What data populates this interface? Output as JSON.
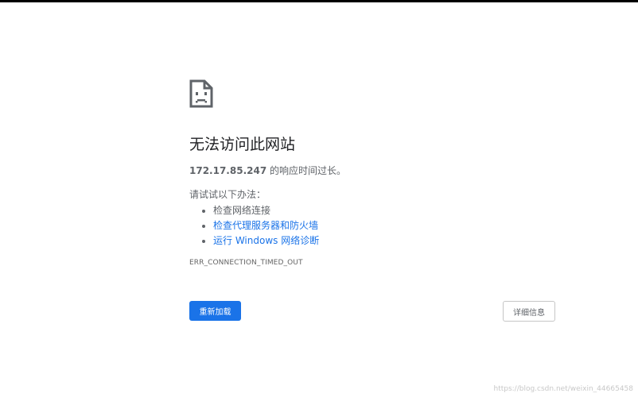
{
  "error_page": {
    "title": "无法访问此网站",
    "host": "172.17.85.247",
    "description_suffix": " 的响应时间过长。",
    "suggestions_heading": "请试试以下办法：",
    "suggestions": [
      {
        "label": "检查网络连接",
        "link": false
      },
      {
        "label": "检查代理服务器和防火墙",
        "link": true
      },
      {
        "label": "运行 Windows 网络诊断",
        "link": true
      }
    ],
    "error_code": "ERR_CONNECTION_TIMED_OUT",
    "reload_label": "重新加载",
    "details_label": "详细信息"
  },
  "watermark": "https://blog.csdn.net/weixin_44665458",
  "icons": {
    "error_icon": "sad-document-icon"
  },
  "colors": {
    "primary": "#1a73e8",
    "text": "#202124",
    "secondary_text": "#5f6368"
  }
}
